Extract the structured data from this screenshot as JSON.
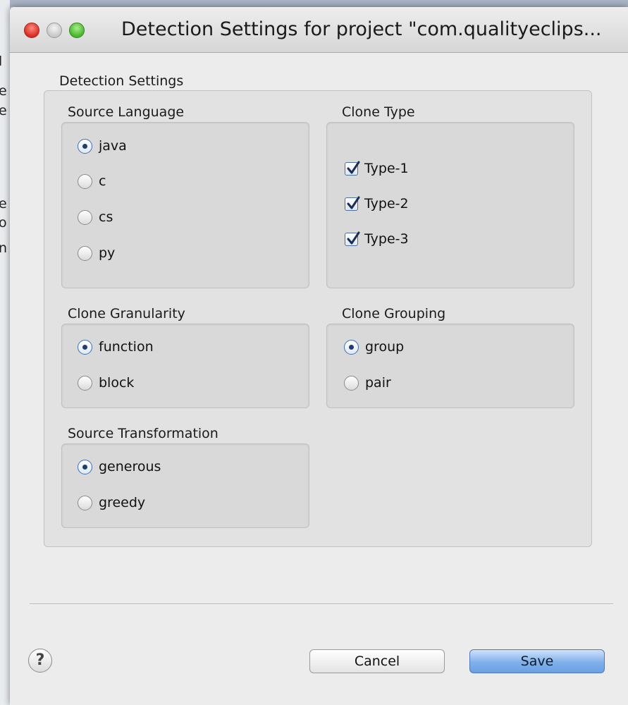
{
  "window": {
    "title": "Detection Settings for project \"com.qualityeclips..."
  },
  "detection_settings": {
    "label": "Detection Settings",
    "source_language": {
      "title": "Source Language",
      "options": [
        {
          "label": "java",
          "selected": true
        },
        {
          "label": "c",
          "selected": false
        },
        {
          "label": "cs",
          "selected": false
        },
        {
          "label": "py",
          "selected": false
        }
      ]
    },
    "clone_type": {
      "title": "Clone Type",
      "options": [
        {
          "label": "Type-1",
          "checked": true
        },
        {
          "label": "Type-2",
          "checked": true
        },
        {
          "label": "Type-3",
          "checked": true
        }
      ]
    },
    "clone_granularity": {
      "title": "Clone Granularity",
      "options": [
        {
          "label": "function",
          "selected": true
        },
        {
          "label": "block",
          "selected": false
        }
      ]
    },
    "clone_grouping": {
      "title": "Clone Grouping",
      "options": [
        {
          "label": "group",
          "selected": true
        },
        {
          "label": "pair",
          "selected": false
        }
      ]
    },
    "source_transformation": {
      "title": "Source Transformation",
      "options": [
        {
          "label": "generous",
          "selected": true
        },
        {
          "label": "greedy",
          "selected": false
        }
      ]
    }
  },
  "buttons": {
    "help_icon": "question-mark-icon",
    "cancel": "Cancel",
    "save": "Save"
  },
  "colors": {
    "save_button": "#7fb0ea",
    "close_button": "#d62c20",
    "maximize_button": "#47b52b"
  }
}
